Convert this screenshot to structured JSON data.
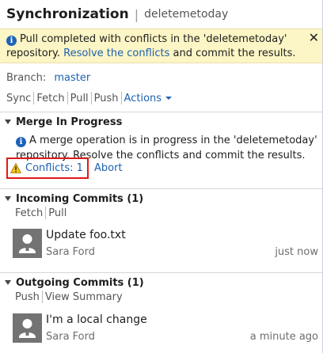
{
  "header": {
    "title": "Synchronization",
    "repo": "deletemetoday"
  },
  "infobar": {
    "text_before": "Pull completed with conflicts in the 'deletemetoday' repository.",
    "link": "Resolve the conflicts",
    "text_after": "and commit the results.",
    "close": "✕"
  },
  "branch": {
    "label": "Branch:",
    "value": "master"
  },
  "toolbar": {
    "sync": "Sync",
    "fetch": "Fetch",
    "pull": "Pull",
    "push": "Push",
    "actions": "Actions"
  },
  "merge": {
    "title": "Merge In Progress",
    "message": "A merge operation is in progress in the 'deletemetoday' repository. Resolve the conflicts and commit the results.",
    "conflicts": "Conflicts: 1",
    "abort": "Abort"
  },
  "incoming": {
    "title": "Incoming Commits (1)",
    "fetch": "Fetch",
    "pull": "Pull",
    "commits": [
      {
        "message": "Update foo.txt",
        "author": "Sara Ford",
        "time": "just now"
      }
    ]
  },
  "outgoing": {
    "title": "Outgoing Commits (1)",
    "push": "Push",
    "view_summary": "View Summary",
    "commits": [
      {
        "message": "I'm a local change",
        "author": "Sara Ford",
        "time": "a minute ago"
      }
    ]
  },
  "colors": {
    "link": "#1e61b0",
    "infobar_bg": "#fcf5c5",
    "highlight_border": "#e01a1a",
    "warning": "#f5c518"
  }
}
